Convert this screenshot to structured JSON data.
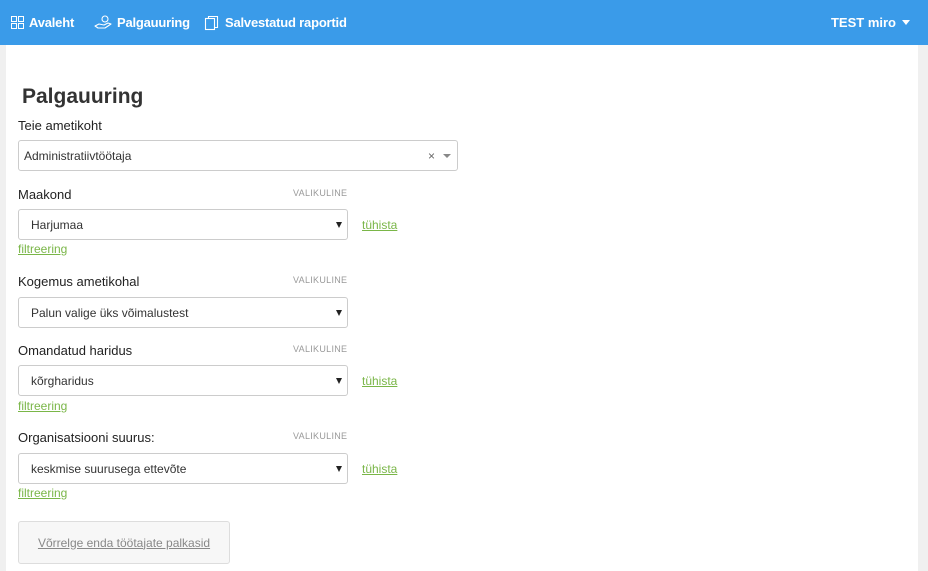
{
  "nav": {
    "home_label": "Avaleht",
    "survey_label": "Palgauuring",
    "reports_label": "Salvestatud raportid",
    "user_label": "TEST miro"
  },
  "page": {
    "title": "Palgauuring"
  },
  "form": {
    "position": {
      "label": "Teie ametikoht",
      "value": "Administratiivtöötaja",
      "clear_glyph": "×"
    },
    "county": {
      "label": "Maakond",
      "optional": "VALIKULINE",
      "value": "Harjumaa",
      "reset_link": "tühista",
      "filter_link": "filtreering"
    },
    "experience": {
      "label": "Kogemus ametikohal",
      "optional": "VALIKULINE",
      "value": "Palun valige üks võimalustest"
    },
    "education": {
      "label": "Omandatud haridus",
      "optional": "VALIKULINE",
      "value": "kõrgharidus",
      "reset_link": "tühista",
      "filter_link": "filtreering"
    },
    "org_size": {
      "label": "Organisatsiooni suurus:",
      "optional": "VALIKULINE",
      "value": "keskmise suurusega ettevõte",
      "reset_link": "tühista",
      "filter_link": "filtreering"
    },
    "compare_button": "Võrrelge enda töötajate palkasid"
  },
  "colors": {
    "topbar": "#3a9be9",
    "link": "#7ab648"
  }
}
